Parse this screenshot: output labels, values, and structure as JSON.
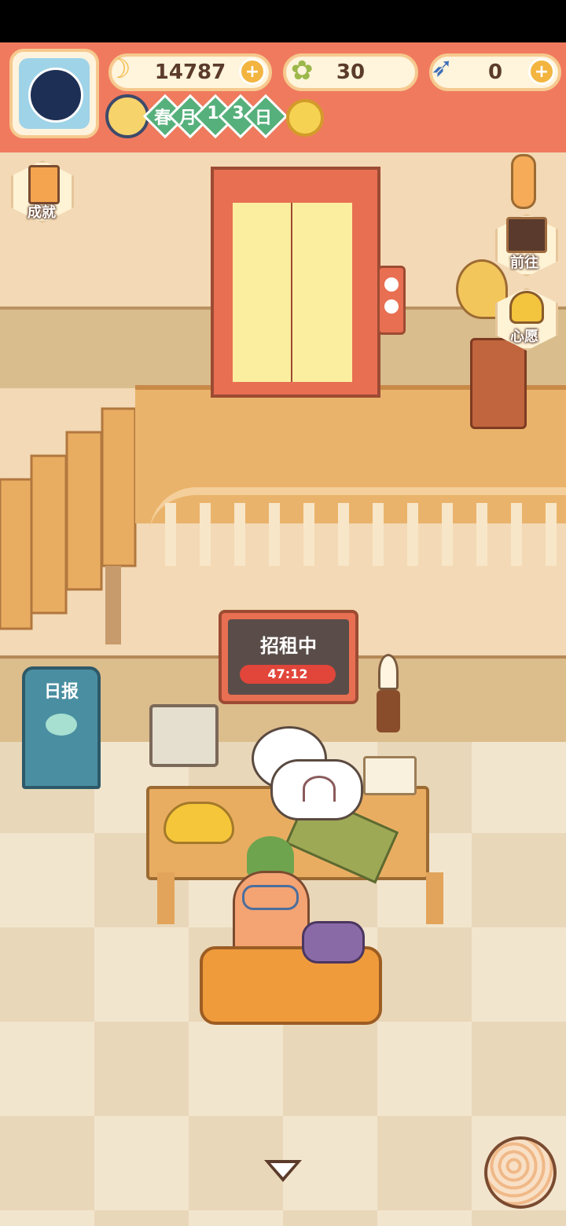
{
  "hud": {
    "bananas": "14787",
    "clovers": "30",
    "fish": "0",
    "date": {
      "season": "春",
      "unit1": "月",
      "day1": "1",
      "day2": "3",
      "unit2": "日"
    },
    "plus_sign": "+"
  },
  "side_buttons": {
    "achievements": "成就",
    "goto": "前往",
    "wish": "心愿"
  },
  "room": {
    "sign_title": "招租中",
    "timer": "47:12",
    "newspaper": "日报"
  },
  "colors": {
    "hud_bg": "#f07a5e",
    "accent_gold": "#f3b540",
    "floor": "#efe0c6",
    "wood": "#eab36b"
  },
  "icons": [
    "banana-icon",
    "clover-icon",
    "fish-icon",
    "moon-icon",
    "sun-icon",
    "clipboard-icon",
    "map-board-icon",
    "heart-book-icon",
    "yarn-ball-icon",
    "down-arrow-icon"
  ]
}
